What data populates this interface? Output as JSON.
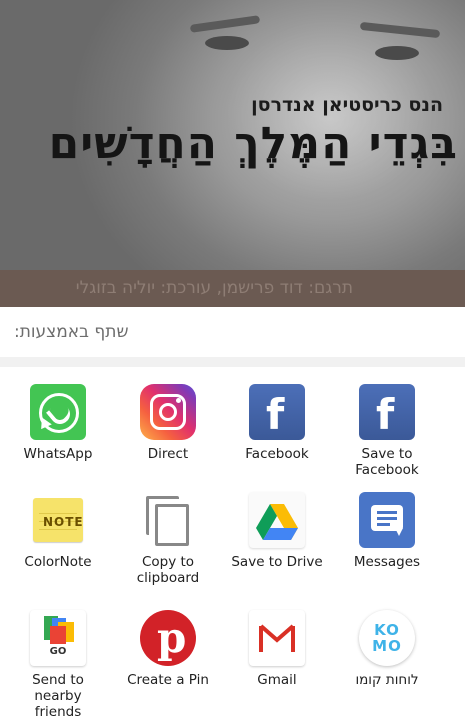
{
  "cover": {
    "author": "הנס כריסטיאן אנדרסן",
    "title": "בִּגְדֵי הַמֶּלֶךְ הַחֲדָשִׁים",
    "credits": "תרגם: דוד פרישמן, עורכת: יוליה בזוגלי"
  },
  "share": {
    "title": "שתף באמצעות:",
    "apps": [
      {
        "label": "WhatsApp",
        "icon": "whatsapp-icon"
      },
      {
        "label": "Direct",
        "icon": "instagram-icon"
      },
      {
        "label": "Facebook",
        "icon": "facebook-icon"
      },
      {
        "label": "Save to Facebook",
        "icon": "facebook-icon"
      },
      {
        "label": "ColorNote",
        "icon": "colornote-icon"
      },
      {
        "label": "Copy to clipboard",
        "icon": "copy-icon"
      },
      {
        "label": "Save to Drive",
        "icon": "google-drive-icon"
      },
      {
        "label": "Messages",
        "icon": "messages-icon"
      },
      {
        "label": "Send to nearby friends",
        "icon": "files-go-icon"
      },
      {
        "label": "Create a Pin",
        "icon": "pinterest-icon"
      },
      {
        "label": "Gmail",
        "icon": "gmail-icon"
      },
      {
        "label": "לוחות קומו",
        "icon": "komo-icon"
      }
    ]
  },
  "icons": {
    "note_text": "NOTE",
    "files_go_text": "GO",
    "komo_top": "KO",
    "komo_bottom": "MO"
  },
  "colors": {
    "whatsapp": "#43c553",
    "facebook": "#3b5998",
    "pinterest": "#d22228",
    "messages": "#4975c7",
    "cover_band": "#6b5a52"
  }
}
